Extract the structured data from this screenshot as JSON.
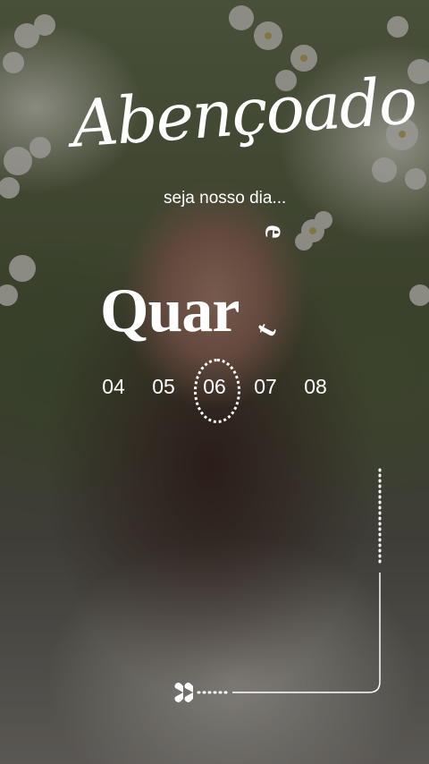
{
  "title": "Abençoado",
  "subtitle": "seja nosso dia...",
  "rotated_e": "e",
  "day_name": "Quar",
  "rotated_t": "t",
  "dates": [
    "04",
    "05",
    "06",
    "07",
    "08"
  ],
  "selected_date": "06",
  "colors": {
    "text": "#ffffff",
    "overlay": "rgba(20,18,16,0.40)"
  }
}
